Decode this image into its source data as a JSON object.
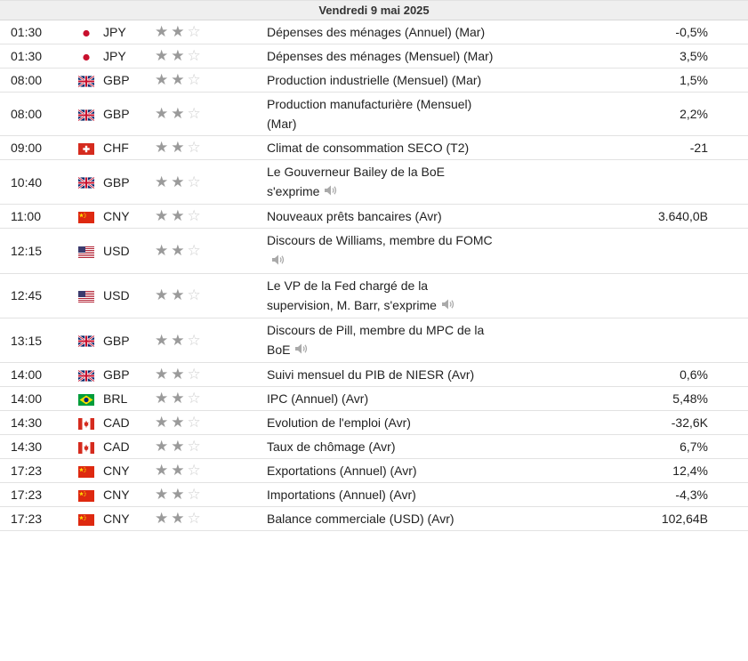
{
  "date_header": "Vendredi 9 mai 2025",
  "rows": [
    {
      "time": "01:30",
      "flag": "jp",
      "currency": "JPY",
      "stars": 2,
      "event": "Dépenses des ménages (Annuel) (Mar)",
      "speech": false,
      "actual": "-0,5%"
    },
    {
      "time": "01:30",
      "flag": "jp",
      "currency": "JPY",
      "stars": 2,
      "event": "Dépenses des ménages (Mensuel) (Mar)",
      "speech": false,
      "actual": "3,5%"
    },
    {
      "time": "08:00",
      "flag": "gb",
      "currency": "GBP",
      "stars": 2,
      "event": "Production industrielle (Mensuel) (Mar)",
      "speech": false,
      "actual": "1,5%"
    },
    {
      "time": "08:00",
      "flag": "gb",
      "currency": "GBP",
      "stars": 2,
      "event": "Production manufacturière (Mensuel) (Mar)",
      "speech": false,
      "actual": "2,2%"
    },
    {
      "time": "09:00",
      "flag": "ch",
      "currency": "CHF",
      "stars": 2,
      "event": "Climat de consommation SECO (T2)",
      "speech": false,
      "actual": "-21"
    },
    {
      "time": "10:40",
      "flag": "gb",
      "currency": "GBP",
      "stars": 2,
      "event": "Le Gouverneur Bailey de la BoE s'exprime",
      "speech": true,
      "actual": ""
    },
    {
      "time": "11:00",
      "flag": "cn",
      "currency": "CNY",
      "stars": 2,
      "event": "Nouveaux prêts bancaires (Avr)",
      "speech": false,
      "actual": "3.640,0B"
    },
    {
      "time": "12:15",
      "flag": "us",
      "currency": "USD",
      "stars": 2,
      "event": "Discours de Williams, membre du FOMC",
      "speech": true,
      "actual": ""
    },
    {
      "time": "12:45",
      "flag": "us",
      "currency": "USD",
      "stars": 2,
      "event": "Le VP de la Fed chargé de la supervision, M. Barr, s'exprime",
      "speech": true,
      "actual": ""
    },
    {
      "time": "13:15",
      "flag": "gb",
      "currency": "GBP",
      "stars": 2,
      "event": "Discours de Pill, membre du MPC de la BoE",
      "speech": true,
      "actual": ""
    },
    {
      "time": "14:00",
      "flag": "gb",
      "currency": "GBP",
      "stars": 2,
      "event": "Suivi mensuel du PIB de NIESR (Avr)",
      "speech": false,
      "actual": "0,6%"
    },
    {
      "time": "14:00",
      "flag": "br",
      "currency": "BRL",
      "stars": 2,
      "event": "IPC (Annuel) (Avr)",
      "speech": false,
      "actual": "5,48%"
    },
    {
      "time": "14:30",
      "flag": "ca",
      "currency": "CAD",
      "stars": 2,
      "event": "Evolution de l'emploi (Avr)",
      "speech": false,
      "actual": "-32,6K"
    },
    {
      "time": "14:30",
      "flag": "ca",
      "currency": "CAD",
      "stars": 2,
      "event": "Taux de chômage (Avr)",
      "speech": false,
      "actual": "6,7%"
    },
    {
      "time": "17:23",
      "flag": "cn",
      "currency": "CNY",
      "stars": 2,
      "event": "Exportations (Annuel) (Avr)",
      "speech": false,
      "actual": "12,4%"
    },
    {
      "time": "17:23",
      "flag": "cn",
      "currency": "CNY",
      "stars": 2,
      "event": "Importations (Annuel) (Avr)",
      "speech": false,
      "actual": "-4,3%"
    },
    {
      "time": "17:23",
      "flag": "cn",
      "currency": "CNY",
      "stars": 2,
      "event": "Balance commerciale (USD) (Avr)",
      "speech": false,
      "actual": "102,64B"
    }
  ]
}
